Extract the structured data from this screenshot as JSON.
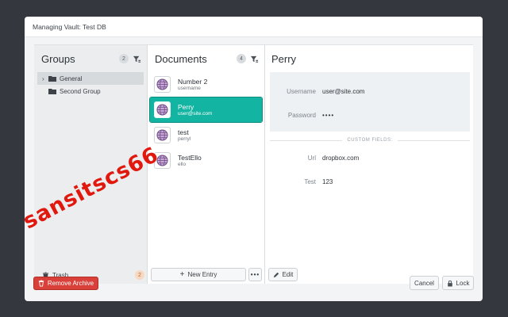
{
  "window": {
    "title": "Managing Vault: Test DB"
  },
  "groups": {
    "title": "Groups",
    "count": "2",
    "items": [
      {
        "label": "General",
        "selected": true
      },
      {
        "label": "Second Group",
        "selected": false
      }
    ],
    "trash": {
      "label": "Trash",
      "count": "2"
    }
  },
  "documents": {
    "title": "Documents",
    "count": "4",
    "items": [
      {
        "name": "Number 2",
        "sub": "username"
      },
      {
        "name": "Perry",
        "sub": "user@site.com"
      },
      {
        "name": "test",
        "sub": "perryl"
      },
      {
        "name": "TestEllo",
        "sub": "ello"
      }
    ],
    "new_entry_label": "New Entry",
    "more_label": "•••"
  },
  "detail": {
    "title": "Perry",
    "username_label": "Username",
    "username_value": "user@site.com",
    "password_label": "Password",
    "password_value": "••••",
    "custom_fields_label": "CUSTOM FIELDS:",
    "custom_fields": [
      {
        "label": "Url",
        "value": "dropbox.com"
      },
      {
        "label": "Test",
        "value": "123"
      }
    ],
    "edit_label": "Edit"
  },
  "footer": {
    "remove_label": "Remove Archive",
    "cancel_label": "Cancel",
    "lock_label": "Lock"
  },
  "watermark": "sansitscs66",
  "colors": {
    "accent": "#13b4a1",
    "danger": "#d9403a"
  },
  "icons": [
    "filter-icon",
    "folder-icon",
    "chevron-right-icon",
    "trash-icon",
    "plus-icon",
    "pencil-icon",
    "lock-icon",
    "globe-icon"
  ]
}
